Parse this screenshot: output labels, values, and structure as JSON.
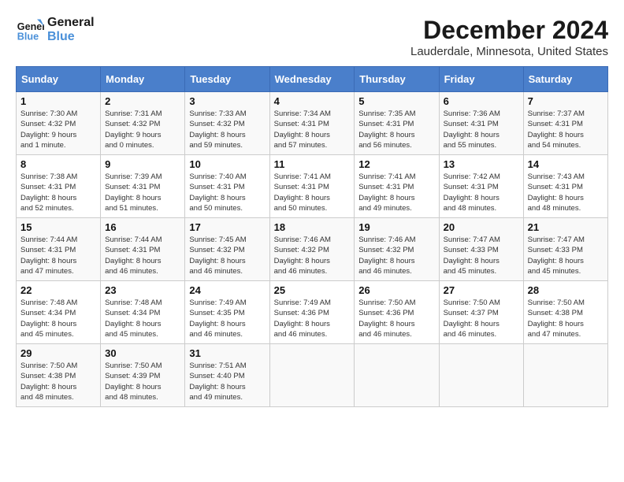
{
  "logo": {
    "line1": "General",
    "line2": "Blue"
  },
  "title": "December 2024",
  "subtitle": "Lauderdale, Minnesota, United States",
  "headers": [
    "Sunday",
    "Monday",
    "Tuesday",
    "Wednesday",
    "Thursday",
    "Friday",
    "Saturday"
  ],
  "weeks": [
    [
      {
        "day": "1",
        "info": "Sunrise: 7:30 AM\nSunset: 4:32 PM\nDaylight: 9 hours\nand 1 minute."
      },
      {
        "day": "2",
        "info": "Sunrise: 7:31 AM\nSunset: 4:32 PM\nDaylight: 9 hours\nand 0 minutes."
      },
      {
        "day": "3",
        "info": "Sunrise: 7:33 AM\nSunset: 4:32 PM\nDaylight: 8 hours\nand 59 minutes."
      },
      {
        "day": "4",
        "info": "Sunrise: 7:34 AM\nSunset: 4:31 PM\nDaylight: 8 hours\nand 57 minutes."
      },
      {
        "day": "5",
        "info": "Sunrise: 7:35 AM\nSunset: 4:31 PM\nDaylight: 8 hours\nand 56 minutes."
      },
      {
        "day": "6",
        "info": "Sunrise: 7:36 AM\nSunset: 4:31 PM\nDaylight: 8 hours\nand 55 minutes."
      },
      {
        "day": "7",
        "info": "Sunrise: 7:37 AM\nSunset: 4:31 PM\nDaylight: 8 hours\nand 54 minutes."
      }
    ],
    [
      {
        "day": "8",
        "info": "Sunrise: 7:38 AM\nSunset: 4:31 PM\nDaylight: 8 hours\nand 52 minutes."
      },
      {
        "day": "9",
        "info": "Sunrise: 7:39 AM\nSunset: 4:31 PM\nDaylight: 8 hours\nand 51 minutes."
      },
      {
        "day": "10",
        "info": "Sunrise: 7:40 AM\nSunset: 4:31 PM\nDaylight: 8 hours\nand 50 minutes."
      },
      {
        "day": "11",
        "info": "Sunrise: 7:41 AM\nSunset: 4:31 PM\nDaylight: 8 hours\nand 50 minutes."
      },
      {
        "day": "12",
        "info": "Sunrise: 7:41 AM\nSunset: 4:31 PM\nDaylight: 8 hours\nand 49 minutes."
      },
      {
        "day": "13",
        "info": "Sunrise: 7:42 AM\nSunset: 4:31 PM\nDaylight: 8 hours\nand 48 minutes."
      },
      {
        "day": "14",
        "info": "Sunrise: 7:43 AM\nSunset: 4:31 PM\nDaylight: 8 hours\nand 48 minutes."
      }
    ],
    [
      {
        "day": "15",
        "info": "Sunrise: 7:44 AM\nSunset: 4:31 PM\nDaylight: 8 hours\nand 47 minutes."
      },
      {
        "day": "16",
        "info": "Sunrise: 7:44 AM\nSunset: 4:31 PM\nDaylight: 8 hours\nand 46 minutes."
      },
      {
        "day": "17",
        "info": "Sunrise: 7:45 AM\nSunset: 4:32 PM\nDaylight: 8 hours\nand 46 minutes."
      },
      {
        "day": "18",
        "info": "Sunrise: 7:46 AM\nSunset: 4:32 PM\nDaylight: 8 hours\nand 46 minutes."
      },
      {
        "day": "19",
        "info": "Sunrise: 7:46 AM\nSunset: 4:32 PM\nDaylight: 8 hours\nand 46 minutes."
      },
      {
        "day": "20",
        "info": "Sunrise: 7:47 AM\nSunset: 4:33 PM\nDaylight: 8 hours\nand 45 minutes."
      },
      {
        "day": "21",
        "info": "Sunrise: 7:47 AM\nSunset: 4:33 PM\nDaylight: 8 hours\nand 45 minutes."
      }
    ],
    [
      {
        "day": "22",
        "info": "Sunrise: 7:48 AM\nSunset: 4:34 PM\nDaylight: 8 hours\nand 45 minutes."
      },
      {
        "day": "23",
        "info": "Sunrise: 7:48 AM\nSunset: 4:34 PM\nDaylight: 8 hours\nand 45 minutes."
      },
      {
        "day": "24",
        "info": "Sunrise: 7:49 AM\nSunset: 4:35 PM\nDaylight: 8 hours\nand 46 minutes."
      },
      {
        "day": "25",
        "info": "Sunrise: 7:49 AM\nSunset: 4:36 PM\nDaylight: 8 hours\nand 46 minutes."
      },
      {
        "day": "26",
        "info": "Sunrise: 7:50 AM\nSunset: 4:36 PM\nDaylight: 8 hours\nand 46 minutes."
      },
      {
        "day": "27",
        "info": "Sunrise: 7:50 AM\nSunset: 4:37 PM\nDaylight: 8 hours\nand 46 minutes."
      },
      {
        "day": "28",
        "info": "Sunrise: 7:50 AM\nSunset: 4:38 PM\nDaylight: 8 hours\nand 47 minutes."
      }
    ],
    [
      {
        "day": "29",
        "info": "Sunrise: 7:50 AM\nSunset: 4:38 PM\nDaylight: 8 hours\nand 48 minutes."
      },
      {
        "day": "30",
        "info": "Sunrise: 7:50 AM\nSunset: 4:39 PM\nDaylight: 8 hours\nand 48 minutes."
      },
      {
        "day": "31",
        "info": "Sunrise: 7:51 AM\nSunset: 4:40 PM\nDaylight: 8 hours\nand 49 minutes."
      },
      {
        "day": "",
        "info": ""
      },
      {
        "day": "",
        "info": ""
      },
      {
        "day": "",
        "info": ""
      },
      {
        "day": "",
        "info": ""
      }
    ]
  ]
}
